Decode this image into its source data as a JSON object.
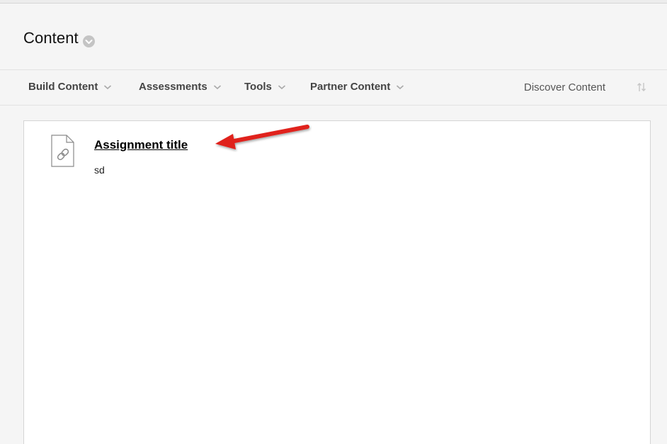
{
  "page": {
    "title": "Content"
  },
  "toolbar": {
    "items": [
      {
        "label": "Build Content"
      },
      {
        "label": "Assessments"
      },
      {
        "label": "Tools"
      },
      {
        "label": "Partner Content"
      }
    ],
    "discover_label": "Discover Content"
  },
  "content_items": [
    {
      "title": "Assignment title",
      "description": "sd",
      "icon": "link-document-icon"
    }
  ],
  "annotation": {
    "type": "arrow",
    "color": "#e0201b"
  },
  "colors": {
    "background": "#f5f5f5",
    "panel": "#ffffff",
    "toolbar_text": "#444444",
    "arrow": "#e0201b"
  }
}
